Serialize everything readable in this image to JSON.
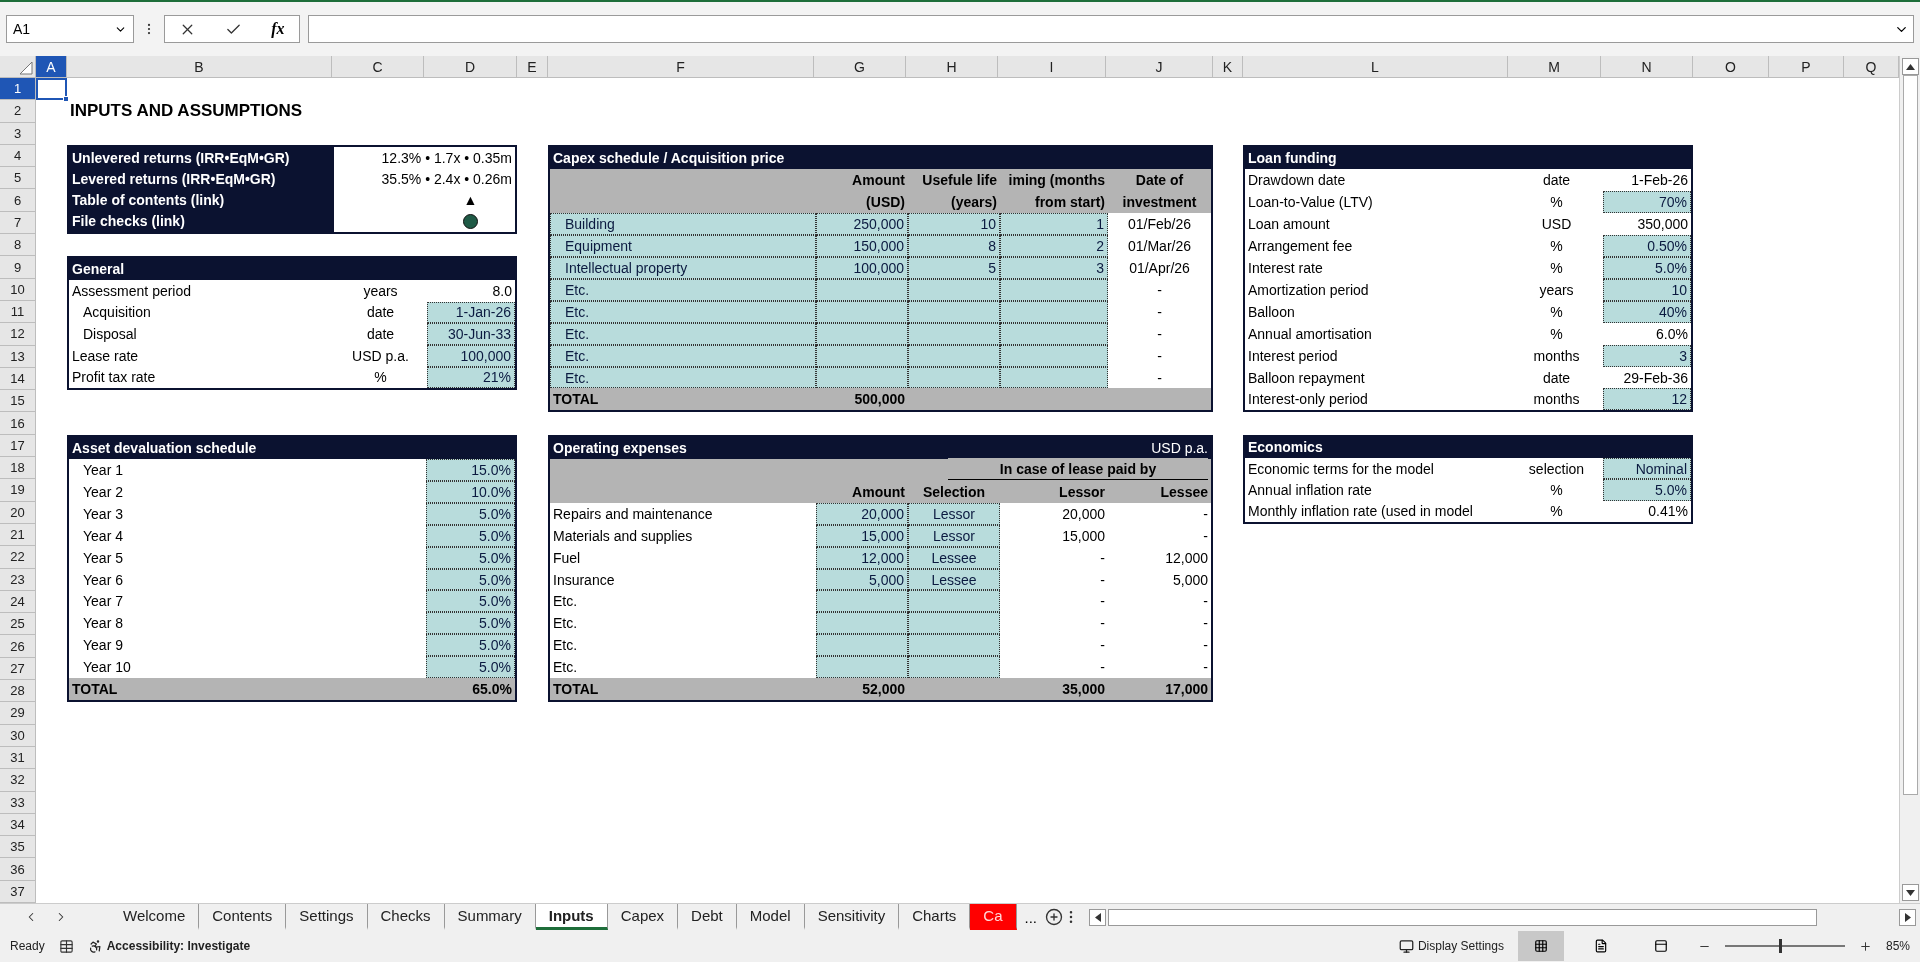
{
  "formula_bar": {
    "name_box": "A1",
    "insert_function": "fx"
  },
  "column_headers": [
    {
      "label": "A",
      "selected": true
    },
    {
      "label": "B",
      "selected": false
    },
    {
      "label": "C",
      "selected": false
    },
    {
      "label": "D",
      "selected": false
    },
    {
      "label": "E",
      "selected": false
    },
    {
      "label": "F",
      "selected": false
    },
    {
      "label": "G",
      "selected": false
    },
    {
      "label": "H",
      "selected": false
    },
    {
      "label": "I",
      "selected": false
    },
    {
      "label": "J",
      "selected": false
    },
    {
      "label": "K",
      "selected": false
    },
    {
      "label": "L",
      "selected": false
    },
    {
      "label": "M",
      "selected": false
    },
    {
      "label": "N",
      "selected": false
    },
    {
      "label": "O",
      "selected": false
    },
    {
      "label": "P",
      "selected": false
    },
    {
      "label": "Q",
      "selected": false
    }
  ],
  "row_numbers": [
    {
      "label": "1",
      "selected": true
    },
    {
      "label": "2",
      "selected": false
    },
    {
      "label": "3",
      "selected": false
    },
    {
      "label": "4",
      "selected": false
    },
    {
      "label": "5",
      "selected": false
    },
    {
      "label": "6",
      "selected": false
    },
    {
      "label": "7",
      "selected": false
    },
    {
      "label": "8",
      "selected": false
    },
    {
      "label": "9",
      "selected": false
    },
    {
      "label": "10",
      "selected": false
    },
    {
      "label": "11",
      "selected": false
    },
    {
      "label": "12",
      "selected": false
    },
    {
      "label": "13",
      "selected": false
    },
    {
      "label": "14",
      "selected": false
    },
    {
      "label": "15",
      "selected": false
    },
    {
      "label": "16",
      "selected": false
    },
    {
      "label": "17",
      "selected": false
    },
    {
      "label": "18",
      "selected": false
    },
    {
      "label": "19",
      "selected": false
    },
    {
      "label": "20",
      "selected": false
    },
    {
      "label": "21",
      "selected": false
    },
    {
      "label": "22",
      "selected": false
    },
    {
      "label": "23",
      "selected": false
    },
    {
      "label": "24",
      "selected": false
    },
    {
      "label": "25",
      "selected": false
    },
    {
      "label": "26",
      "selected": false
    },
    {
      "label": "27",
      "selected": false
    },
    {
      "label": "28",
      "selected": false
    },
    {
      "label": "29",
      "selected": false
    },
    {
      "label": "30",
      "selected": false
    },
    {
      "label": "31",
      "selected": false
    },
    {
      "label": "32",
      "selected": false
    },
    {
      "label": "33",
      "selected": false
    },
    {
      "label": "34",
      "selected": false
    },
    {
      "label": "35",
      "selected": false
    },
    {
      "label": "36",
      "selected": false
    },
    {
      "label": "37",
      "selected": false
    }
  ],
  "title": "INPUTS AND ASSUMPTIONS",
  "summary": {
    "rows": [
      {
        "kind": "text",
        "label": "Unlevered returns (IRR•EqM•GR)",
        "value": "12.3% • 1.7x • 0.35m"
      },
      {
        "kind": "text",
        "label": "Levered returns (IRR•EqM•GR)",
        "value": "35.5% • 2.4x • 0.26m"
      },
      {
        "kind": "symbol",
        "label": "Table of contents (link)",
        "value": "▲"
      },
      {
        "kind": "dot",
        "label": "File checks (link)",
        "color": "#1f5a46"
      }
    ]
  },
  "general": {
    "title": "General",
    "rows": [
      {
        "label": "Assessment period",
        "unit": "years",
        "value": "8.0",
        "input": false,
        "children": [
          {
            "label": "Acquisition",
            "unit": "date",
            "value": "1-Jan-26",
            "input": true
          },
          {
            "label": "Disposal",
            "unit": "date",
            "value": "30-Jun-33",
            "input": true
          }
        ]
      },
      {
        "label": "Lease rate",
        "unit": "USD p.a.",
        "value": "100,000",
        "input": true
      },
      {
        "label": "Profit tax rate",
        "unit": "%",
        "value": "21%",
        "input": true
      }
    ]
  },
  "asset_devaluation": {
    "title": "Asset devaluation schedule",
    "rows": [
      {
        "label": "Year 1",
        "value": "15.0%"
      },
      {
        "label": "Year 2",
        "value": "10.0%"
      },
      {
        "label": "Year 3",
        "value": "5.0%"
      },
      {
        "label": "Year 4",
        "value": "5.0%"
      },
      {
        "label": "Year 5",
        "value": "5.0%"
      },
      {
        "label": "Year 6",
        "value": "5.0%"
      },
      {
        "label": "Year 7",
        "value": "5.0%"
      },
      {
        "label": "Year 8",
        "value": "5.0%"
      },
      {
        "label": "Year 9",
        "value": "5.0%"
      },
      {
        "label": "Year 10",
        "value": "5.0%"
      }
    ],
    "total": {
      "label": "TOTAL",
      "value": "65.0%"
    }
  },
  "capex": {
    "title": "Capex schedule / Acquisition price",
    "columns": [
      {
        "line_1": "Amount",
        "line_2": "(USD)"
      },
      {
        "line_1": "Usefule life",
        "line_2": "(years)"
      },
      {
        "line_1": "iming (months",
        "line_2": "from start)"
      },
      {
        "line_1": "Date of",
        "line_2": "investment"
      }
    ],
    "rows": [
      {
        "label": "Building",
        "amount": "250,000",
        "life": "10",
        "timing": "1",
        "date": "01/Feb/26"
      },
      {
        "label": "Equipment",
        "amount": "150,000",
        "life": "8",
        "timing": "2",
        "date": "01/Mar/26"
      },
      {
        "label": "Intellectual property",
        "amount": "100,000",
        "life": "5",
        "timing": "3",
        "date": "01/Apr/26"
      },
      {
        "label": "Etc.",
        "date": "-"
      },
      {
        "label": "Etc.",
        "date": "-"
      },
      {
        "label": "Etc.",
        "date": "-"
      },
      {
        "label": "Etc.",
        "date": "-"
      },
      {
        "label": "Etc.",
        "date": "-"
      }
    ],
    "total": {
      "label": "TOTAL",
      "amount": "500,000"
    }
  },
  "opex": {
    "title": "Operating expenses",
    "unit": "USD p.a.",
    "group_header": "In case of lease paid by",
    "columns": [
      "Amount",
      "Selection",
      "Lessor",
      "Lessee"
    ],
    "rows": [
      {
        "label": "Repairs and maintenance",
        "amount": "20,000",
        "selection": "Lessor",
        "lessor": "20,000",
        "lessee": "-"
      },
      {
        "label": "Materials and supplies",
        "amount": "15,000",
        "selection": "Lessor",
        "lessor": "15,000",
        "lessee": "-"
      },
      {
        "label": "Fuel",
        "amount": "12,000",
        "selection": "Lessee",
        "lessor": "-",
        "lessee": "12,000"
      },
      {
        "label": "Insurance",
        "amount": "5,000",
        "selection": "Lessee",
        "lessor": "-",
        "lessee": "5,000"
      },
      {
        "label": "Etc.",
        "lessor": "-",
        "lessee": "-"
      },
      {
        "label": "Etc.",
        "lessor": "-",
        "lessee": "-"
      },
      {
        "label": "Etc.",
        "lessor": "-",
        "lessee": "-"
      },
      {
        "label": "Etc.",
        "lessor": "-",
        "lessee": "-"
      }
    ],
    "total": {
      "label": "TOTAL",
      "amount": "52,000",
      "lessor": "35,000",
      "lessee": "17,000"
    }
  },
  "loan_funding": {
    "title": "Loan funding",
    "rows": [
      {
        "label": "Drawdown date",
        "unit": "date",
        "value": "1-Feb-26",
        "input": false
      },
      {
        "label": "Loan-to-Value (LTV)",
        "unit": "%",
        "value": "70%",
        "input": true
      },
      {
        "label": "Loan amount",
        "unit": "USD",
        "value": "350,000",
        "input": false
      },
      {
        "label": "Arrangement fee",
        "unit": "%",
        "value": "0.50%",
        "input": true
      },
      {
        "label": "Interest rate",
        "unit": "%",
        "value": "5.0%",
        "input": true
      },
      {
        "label": "Amortization period",
        "unit": "years",
        "value": "10",
        "input": true
      },
      {
        "label": "Balloon",
        "unit": "%",
        "value": "40%",
        "input": true
      },
      {
        "label": "Annual amortisation",
        "unit": "%",
        "value": "6.0%",
        "input": false
      },
      {
        "label": "Interest period",
        "unit": "months",
        "value": "3",
        "input": true
      },
      {
        "label": "Balloon repayment",
        "unit": "date",
        "value": "29-Feb-36",
        "input": false
      },
      {
        "label": "Interest-only period",
        "unit": "months",
        "value": "12",
        "input": true
      }
    ]
  },
  "economics": {
    "title": "Economics",
    "rows": [
      {
        "label": "Economic terms for the model",
        "unit": "selection",
        "value": "Nominal",
        "input": true
      },
      {
        "label": "Annual inflation rate",
        "unit": "%",
        "value": "5.0%",
        "input": true
      },
      {
        "label": "Monthly inflation rate (used in model",
        "unit": "%",
        "value": "0.41%",
        "input": false
      }
    ]
  },
  "sheet_tabs": [
    {
      "label": "Welcome",
      "selected": false
    },
    {
      "label": "Contents",
      "selected": false
    },
    {
      "label": "Settings",
      "selected": false
    },
    {
      "label": "Checks",
      "selected": false
    },
    {
      "label": "Summary",
      "selected": false
    },
    {
      "label": "Inputs",
      "selected": true
    },
    {
      "label": "Capex",
      "selected": false
    },
    {
      "label": "Debt",
      "selected": false
    },
    {
      "label": "Model",
      "selected": false
    },
    {
      "label": "Sensitivity",
      "selected": false
    },
    {
      "label": "Charts",
      "selected": false
    },
    {
      "label": "Ca",
      "selected": false,
      "color": "#ff0000"
    }
  ],
  "more_tabs": "...",
  "status_bar": {
    "mode": "Ready",
    "accessibility": "Accessibility: Investigate",
    "display_settings": "Display Settings",
    "views": [
      {
        "selected": true
      },
      {
        "selected": false
      },
      {
        "selected": false
      }
    ],
    "zoom_slider": {
      "level": 0.45
    },
    "zoom": "85%"
  }
}
